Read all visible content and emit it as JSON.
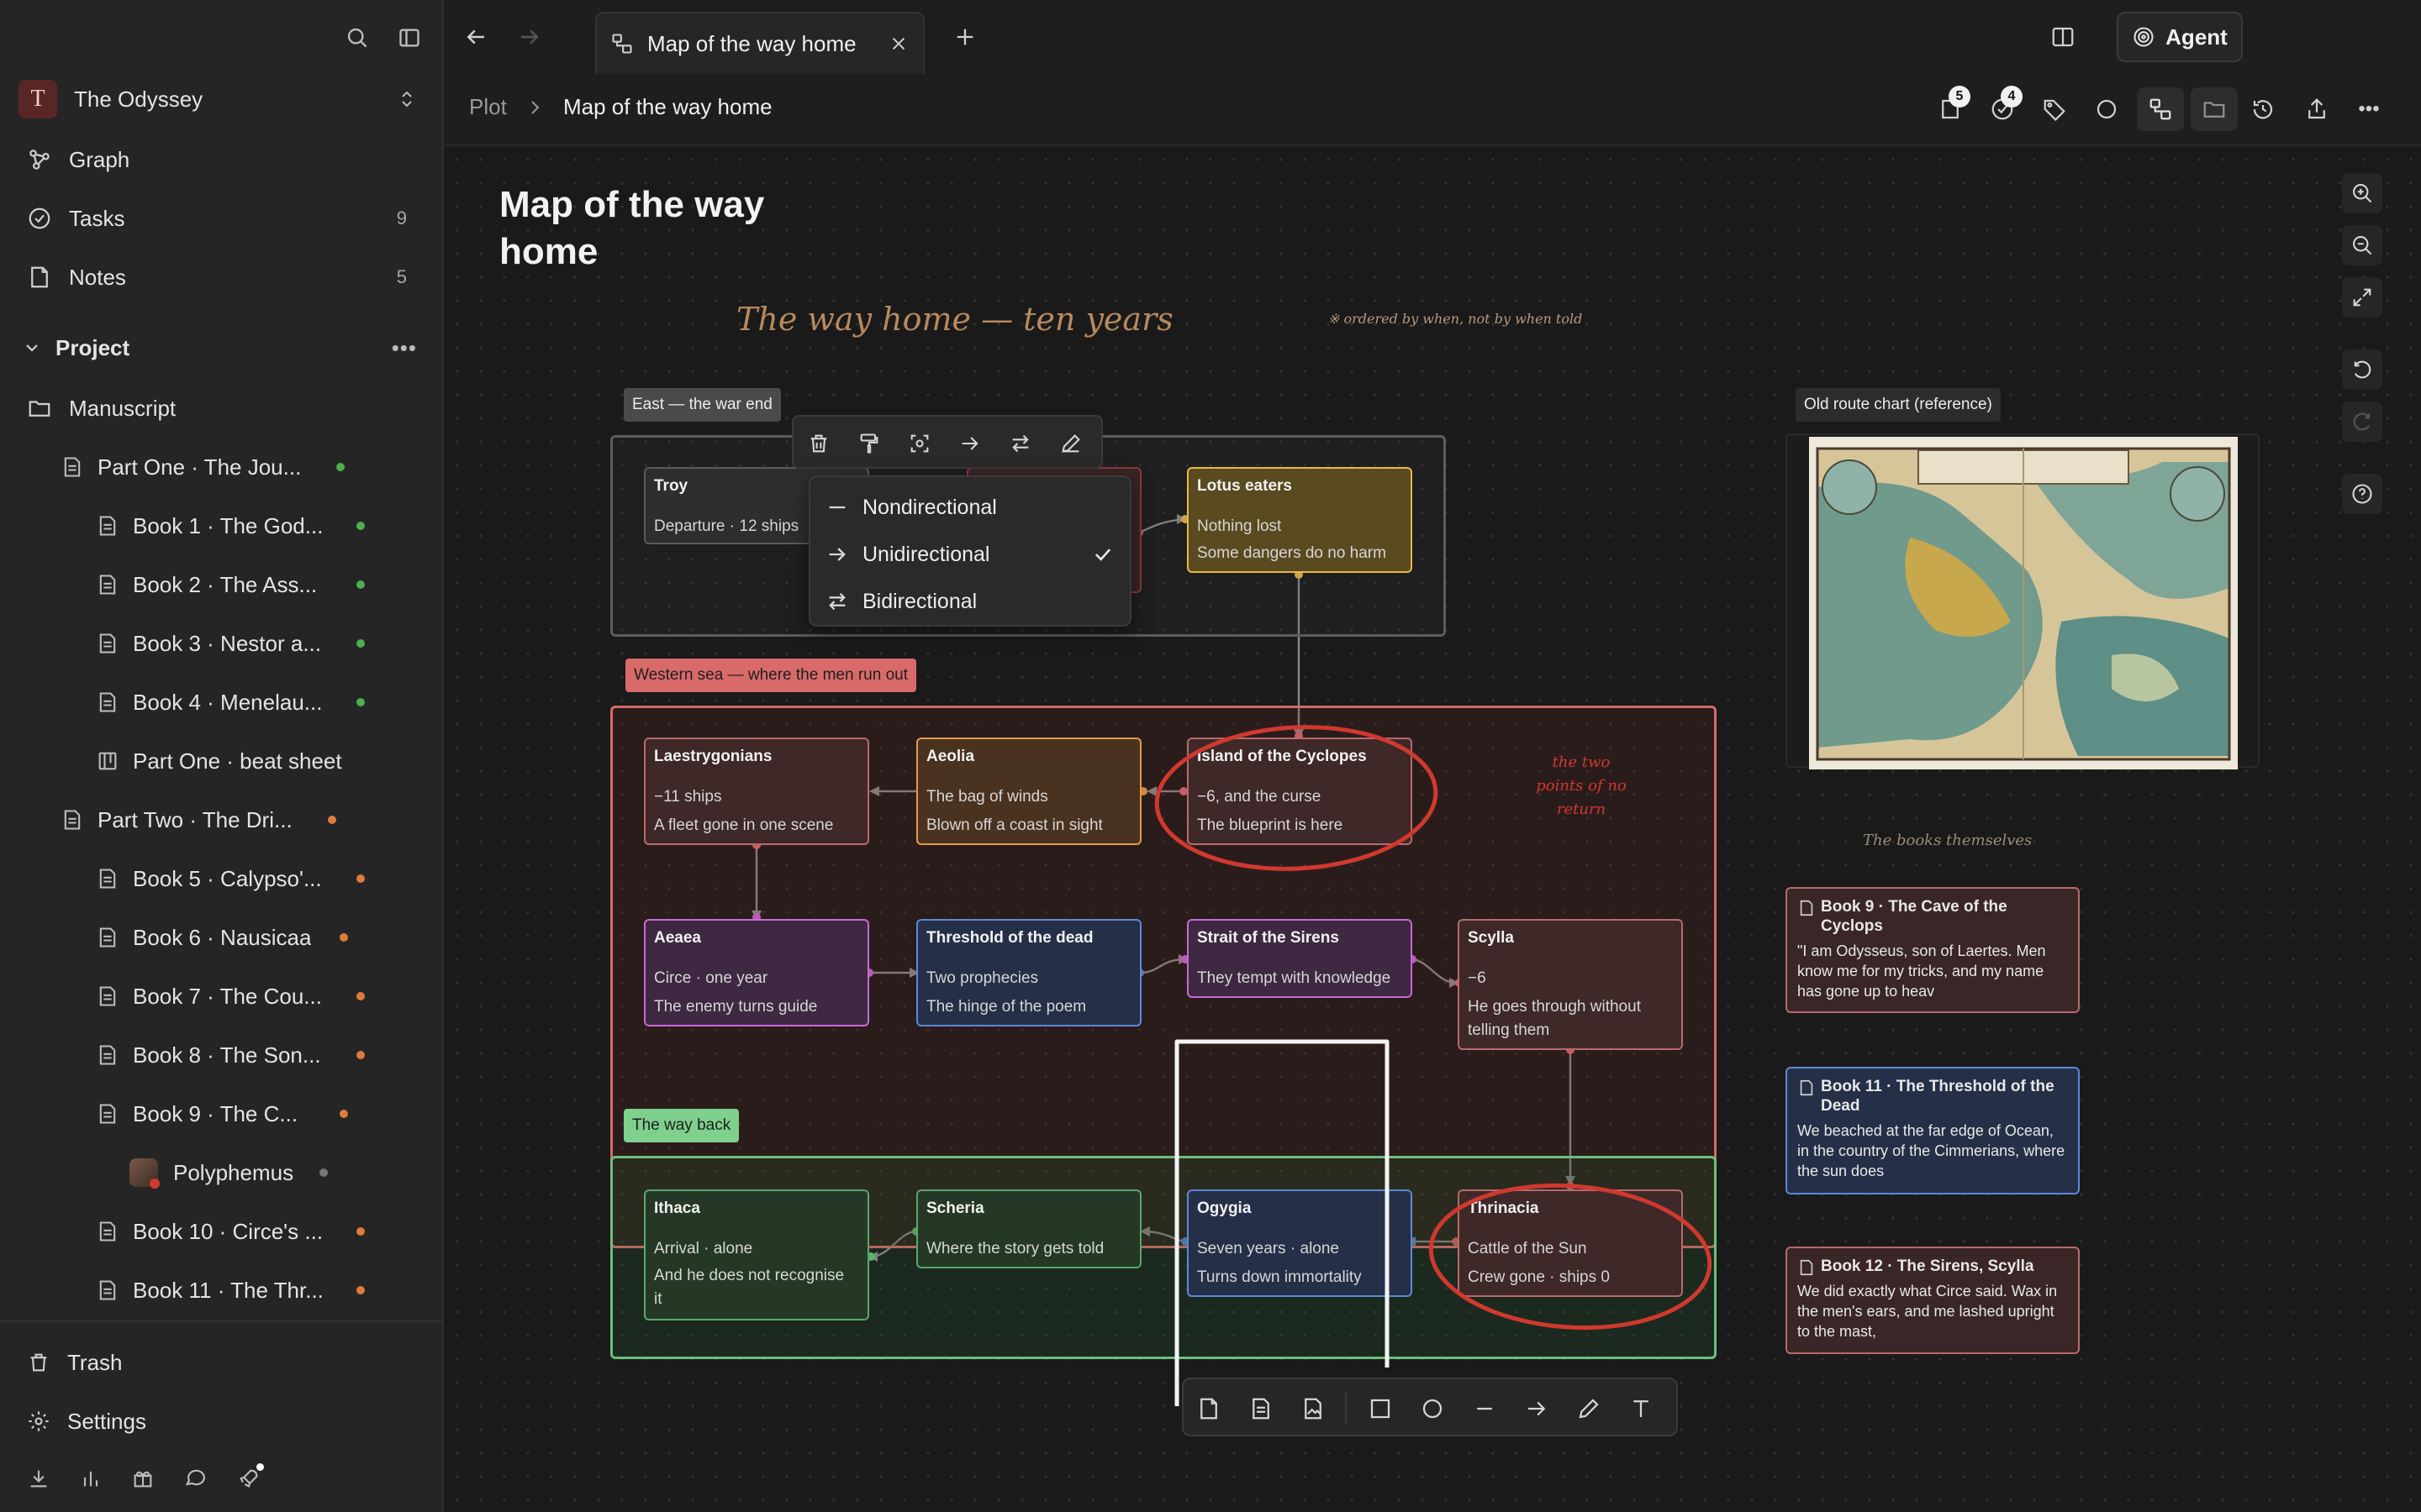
{
  "workspace": {
    "initial": "T",
    "name": "The Odyssey"
  },
  "nav": [
    {
      "label": "Graph",
      "icon": "graph-icon"
    },
    {
      "label": "Tasks",
      "icon": "check-circle-icon",
      "count": "9"
    },
    {
      "label": "Notes",
      "icon": "note-icon",
      "count": "5"
    }
  ],
  "project": {
    "label": "Project"
  },
  "tree": [
    {
      "label": "Manuscript"
    },
    {
      "label": "Part One · The Jou...",
      "dot": "#4caf50"
    },
    {
      "label": "Book 1 · The God...",
      "dot": "#4caf50"
    },
    {
      "label": "Book 2 · The Ass...",
      "dot": "#4caf50"
    },
    {
      "label": "Book 3 · Nestor a...",
      "dot": "#4caf50"
    },
    {
      "label": "Book 4 · Menelau...",
      "dot": "#4caf50"
    },
    {
      "label": "Part One · beat sheet"
    },
    {
      "label": "Part Two · The Dri...",
      "dot": "#e07b3c"
    },
    {
      "label": "Book 5 · Calypso'...",
      "dot": "#e07b3c"
    },
    {
      "label": "Book 6 · Nausicaa",
      "dot": "#e07b3c"
    },
    {
      "label": "Book 7 · The Cou...",
      "dot": "#e07b3c"
    },
    {
      "label": "Book 8 · The Son...",
      "dot": "#e07b3c"
    },
    {
      "label": "Book 9 · The C...",
      "dot": "#e07b3c"
    },
    {
      "label": "Polyphemus",
      "dot": "#777777"
    },
    {
      "label": "Book 10 · Circe's ...",
      "dot": "#e07b3c"
    },
    {
      "label": "Book 11 · The Thr...",
      "dot": "#e07b3c"
    }
  ],
  "bottom_nav": {
    "trash": "Trash",
    "settings": "Settings"
  },
  "tab": {
    "title": "Map of the way home"
  },
  "agent_label": "Agent",
  "breadcrumb": {
    "parent": "Plot",
    "current": "Map of the way home"
  },
  "toolbar_badges": {
    "notes": "5",
    "tasks": "4"
  },
  "page_title_lines": [
    "Map of the way",
    "home"
  ],
  "canvas_text": {
    "heading": "The way home — ten years",
    "note": "※ ordered by when, not by when told",
    "points_note": "the two points of no return",
    "books_note": "The books themselves",
    "image_label": "Old route chart (reference)"
  },
  "groups": {
    "east": "East — the war end",
    "western": "Western sea — where the men run out",
    "back": "The way back"
  },
  "nodes": {
    "troy": {
      "title": "Troy",
      "lines": [
        "Departure · 12 ships"
      ]
    },
    "lotus": {
      "title": "Lotus eaters",
      "lines": [
        "Nothing lost",
        "Some dangers do no harm"
      ]
    },
    "laestry": {
      "title": "Laestrygonians",
      "lines": [
        "−11 ships",
        "A fleet gone in one scene"
      ]
    },
    "aeolia": {
      "title": "Aeolia",
      "lines": [
        "The bag of winds",
        "Blown off a coast in sight"
      ]
    },
    "cyclopes": {
      "title": "Island of the Cyclopes",
      "lines": [
        "−6, and the curse",
        "The blueprint is here"
      ]
    },
    "aeaea": {
      "title": "Aeaea",
      "lines": [
        "Circe · one year",
        "The enemy turns guide"
      ]
    },
    "threshold": {
      "title": "Threshold of the dead",
      "lines": [
        "Two prophecies",
        "The hinge of the poem"
      ]
    },
    "sirens": {
      "title": "Strait of the Sirens",
      "lines": [
        "They tempt with knowledge"
      ]
    },
    "scylla": {
      "title": "Scylla",
      "lines": [
        "−6",
        "He goes through without",
        "telling them"
      ]
    },
    "ithaca": {
      "title": "Ithaca",
      "lines": [
        "Arrival · alone",
        "And he does not recognise",
        "it"
      ]
    },
    "scheria": {
      "title": "Scheria",
      "lines": [
        "Where the story gets told"
      ]
    },
    "ogygia": {
      "title": "Ogygia",
      "lines": [
        "Seven years · alone",
        "Turns down immortality"
      ]
    },
    "thrinacia": {
      "title": "Thrinacia",
      "lines": [
        "Cattle of the Sun",
        "Crew gone · ships 0"
      ]
    }
  },
  "cards": [
    {
      "title": "Book 9 · The Cave of the Cyclops",
      "text": "\"I am Odysseus, son of Laertes. Men know me for my tricks, and my name has gone up to heav"
    },
    {
      "title": "Book 11 · The Threshold of the Dead",
      "text": "We beached at the far edge of Ocean, in the country of the Cimmerians, where the sun does"
    },
    {
      "title": "Book 12 · The Sirens, Scylla",
      "text": "We did exactly what Circe said. Wax in the men's ears, and me lashed upright to the mast,"
    }
  ],
  "direction_menu": {
    "items": [
      "Nondirectional",
      "Unidirectional",
      "Bidirectional"
    ],
    "selected": "Unidirectional"
  },
  "colors": {
    "accent_red": "#d0392e",
    "group_east": "#5a5a5a",
    "group_western": "#d36a6a",
    "group_back": "#6cc07a",
    "dot_green": "#4caf50",
    "dot_orange": "#e07b3c"
  }
}
